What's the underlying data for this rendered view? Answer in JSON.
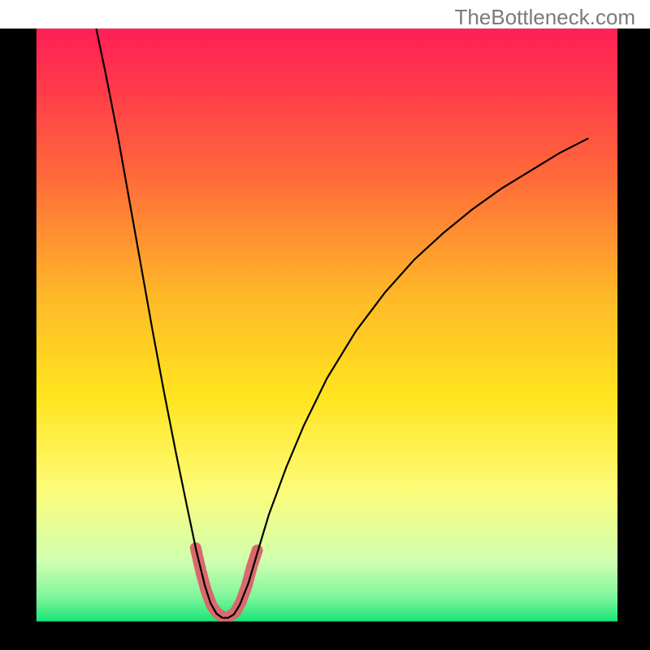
{
  "watermark": "TheBottleneck.com",
  "chart_data": {
    "type": "line",
    "title": "",
    "xlabel": "",
    "ylabel": "",
    "xlim": [
      0,
      100
    ],
    "ylim": [
      0,
      100
    ],
    "frame": {
      "x": 5.6,
      "y": 4.4,
      "width": 89.4,
      "height": 91.2
    },
    "background_gradient": {
      "stops": [
        {
          "offset": 0.0,
          "color": "#ff1f55"
        },
        {
          "offset": 0.1,
          "color": "#ff3a4b"
        },
        {
          "offset": 0.25,
          "color": "#ff6a3a"
        },
        {
          "offset": 0.45,
          "color": "#ffb828"
        },
        {
          "offset": 0.62,
          "color": "#ffe41e"
        },
        {
          "offset": 0.78,
          "color": "#fdfc7a"
        },
        {
          "offset": 0.9,
          "color": "#cfffb0"
        },
        {
          "offset": 0.96,
          "color": "#7cf59a"
        },
        {
          "offset": 1.0,
          "color": "#17e676"
        }
      ]
    },
    "series": [
      {
        "name": "bottleneck-curve",
        "style": {
          "stroke": "#000000",
          "width": 2.2,
          "fill": "none"
        },
        "points": [
          {
            "x": 10.3,
            "y": 100.0
          },
          {
            "x": 12.0,
            "y": 92.0
          },
          {
            "x": 14.0,
            "y": 82.0
          },
          {
            "x": 16.0,
            "y": 71.0
          },
          {
            "x": 18.0,
            "y": 60.0
          },
          {
            "x": 20.0,
            "y": 49.0
          },
          {
            "x": 22.0,
            "y": 38.5
          },
          {
            "x": 24.0,
            "y": 28.5
          },
          {
            "x": 26.0,
            "y": 19.0
          },
          {
            "x": 27.5,
            "y": 12.0
          },
          {
            "x": 29.0,
            "y": 6.0
          },
          {
            "x": 30.0,
            "y": 3.0
          },
          {
            "x": 31.0,
            "y": 1.3
          },
          {
            "x": 32.0,
            "y": 0.6
          },
          {
            "x": 33.0,
            "y": 0.6
          },
          {
            "x": 34.0,
            "y": 1.2
          },
          {
            "x": 35.0,
            "y": 2.8
          },
          {
            "x": 36.5,
            "y": 6.5
          },
          {
            "x": 38.0,
            "y": 11.5
          },
          {
            "x": 40.0,
            "y": 18.0
          },
          {
            "x": 43.0,
            "y": 26.0
          },
          {
            "x": 46.0,
            "y": 33.0
          },
          {
            "x": 50.0,
            "y": 41.0
          },
          {
            "x": 55.0,
            "y": 49.0
          },
          {
            "x": 60.0,
            "y": 55.5
          },
          {
            "x": 65.0,
            "y": 61.0
          },
          {
            "x": 70.0,
            "y": 65.5
          },
          {
            "x": 75.0,
            "y": 69.5
          },
          {
            "x": 80.0,
            "y": 73.0
          },
          {
            "x": 85.0,
            "y": 76.0
          },
          {
            "x": 90.0,
            "y": 79.0
          },
          {
            "x": 95.0,
            "y": 81.5
          }
        ]
      },
      {
        "name": "dip-highlight",
        "style": {
          "stroke": "#d9696d",
          "width": 14,
          "fill": "none",
          "linecap": "round",
          "linejoin": "round"
        },
        "points": [
          {
            "x": 27.4,
            "y": 12.4
          },
          {
            "x": 28.3,
            "y": 8.5
          },
          {
            "x": 29.2,
            "y": 5.2
          },
          {
            "x": 30.2,
            "y": 2.6
          },
          {
            "x": 31.2,
            "y": 1.3
          },
          {
            "x": 32.2,
            "y": 0.7
          },
          {
            "x": 33.2,
            "y": 0.8
          },
          {
            "x": 34.2,
            "y": 1.5
          },
          {
            "x": 35.2,
            "y": 3.3
          },
          {
            "x": 36.2,
            "y": 6.0
          },
          {
            "x": 37.1,
            "y": 9.3
          },
          {
            "x": 38.0,
            "y": 12.0
          }
        ]
      }
    ]
  }
}
